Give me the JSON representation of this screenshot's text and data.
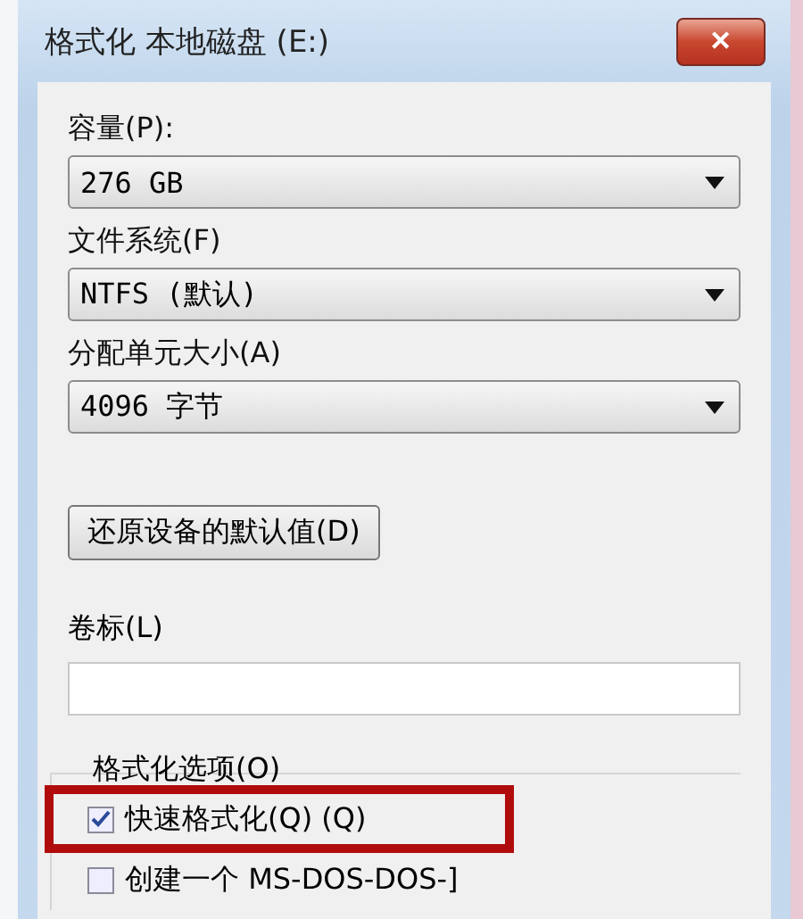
{
  "window": {
    "title": "格式化 本地磁盘 (E:)",
    "close_glyph": "✕"
  },
  "fields": [
    {
      "kind": "combo",
      "label": "容量(P):",
      "value": "276 GB"
    },
    {
      "kind": "combo",
      "label": "文件系统(F)",
      "value": "NTFS (默认)"
    },
    {
      "kind": "combo",
      "label": "分配单元大小(A)",
      "value": "4096 字节"
    },
    {
      "kind": "button",
      "label": "还原设备的默认值(D)"
    },
    {
      "kind": "text",
      "label": "卷标(L)"
    }
  ],
  "format_options": {
    "label": "格式化选项(O)",
    "options": [
      {
        "label": "快速格式化(Q) (Q)",
        "checked": true,
        "highlighted": true
      },
      {
        "label": "创建一个 MS-DOS-DOS-]",
        "checked": false,
        "highlighted": false
      }
    ]
  }
}
